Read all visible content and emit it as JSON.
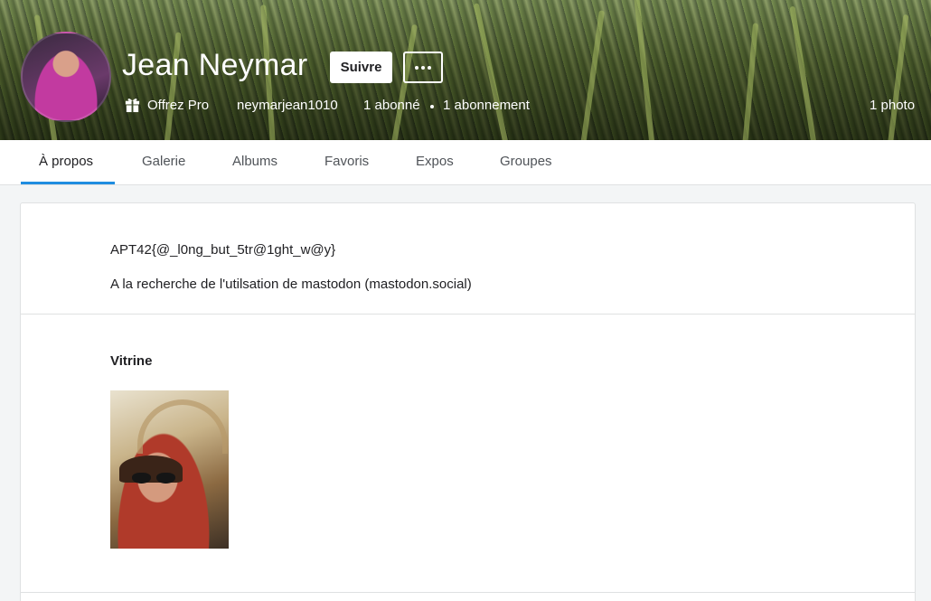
{
  "profile": {
    "name": "Jean Neymar",
    "follow_label": "Suivre",
    "more_icon": "ellipsis-icon",
    "offer_pro": "Offrez Pro",
    "username": "neymarjean1010",
    "followers": "1 abonné",
    "following": "1 abonnement",
    "photo_count": "1 photo"
  },
  "tabs": [
    {
      "label": "À propos",
      "active": true
    },
    {
      "label": "Galerie"
    },
    {
      "label": "Albums"
    },
    {
      "label": "Favoris"
    },
    {
      "label": "Expos"
    },
    {
      "label": "Groupes"
    }
  ],
  "about": {
    "bio_line1": "APT42{@_l0ng_but_5tr@1ght_w@y}",
    "bio_line2": "A la recherche de l'utilsation de mastodon (mastodon.social)",
    "showcase_title": "Vitrine"
  },
  "colors": {
    "accent": "#1f8de0",
    "page_bg": "#f3f5f6",
    "card_bg": "#ffffff"
  }
}
